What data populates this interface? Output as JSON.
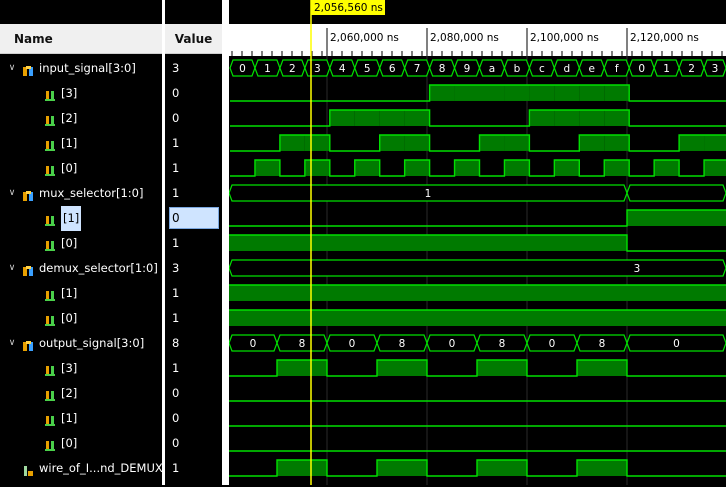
{
  "header": {
    "name_label": "Name",
    "value_label": "Value"
  },
  "cursor": {
    "label": "2,056,560 ns",
    "time_ns": 2056560
  },
  "timeline": {
    "ticks": [
      "2,060,000 ns",
      "2,080,000 ns",
      "2,100,000 ns",
      "2,120,000 ns"
    ]
  },
  "signals": [
    {
      "name": "input_signal[3:0]",
      "value": "3",
      "kind": "bus",
      "expanded": true,
      "indent": 0
    },
    {
      "name": "[3]",
      "value": "0",
      "kind": "bit",
      "indent": 1
    },
    {
      "name": "[2]",
      "value": "0",
      "kind": "bit",
      "indent": 1
    },
    {
      "name": "[1]",
      "value": "1",
      "kind": "bit",
      "indent": 1
    },
    {
      "name": "[0]",
      "value": "1",
      "kind": "bit",
      "indent": 1
    },
    {
      "name": "mux_selector[1:0]",
      "value": "1",
      "kind": "bus",
      "expanded": true,
      "indent": 0
    },
    {
      "name": "[1]",
      "value": "0",
      "kind": "bit",
      "indent": 1,
      "selected": true
    },
    {
      "name": "[0]",
      "value": "1",
      "kind": "bit",
      "indent": 1
    },
    {
      "name": "demux_selector[1:0]",
      "value": "3",
      "kind": "bus",
      "expanded": true,
      "indent": 0
    },
    {
      "name": "[1]",
      "value": "1",
      "kind": "bit",
      "indent": 1
    },
    {
      "name": "[0]",
      "value": "1",
      "kind": "bit",
      "indent": 1
    },
    {
      "name": "output_signal[3:0]",
      "value": "8",
      "kind": "bus",
      "expanded": true,
      "indent": 0
    },
    {
      "name": "[3]",
      "value": "1",
      "kind": "bit",
      "indent": 1
    },
    {
      "name": "[2]",
      "value": "0",
      "kind": "bit",
      "indent": 1
    },
    {
      "name": "[1]",
      "value": "0",
      "kind": "bit",
      "indent": 1
    },
    {
      "name": "[0]",
      "value": "0",
      "kind": "bit",
      "indent": 1
    },
    {
      "name": "wire_of_I...nd_DEMUX",
      "value": "1",
      "kind": "wire",
      "indent": 0
    }
  ],
  "bus_labels": {
    "input": [
      "0",
      "1",
      "2",
      "3",
      "4",
      "5",
      "6",
      "7",
      "8",
      "9",
      "a",
      "b",
      "c",
      "d",
      "e",
      "f",
      "0",
      "1",
      "2",
      "3"
    ],
    "mux": [
      "1"
    ],
    "demux": [
      "3"
    ],
    "output": [
      "0",
      "8",
      "0",
      "8",
      "0",
      "8",
      "0",
      "8",
      "0"
    ]
  },
  "colors": {
    "wave": "#00e000",
    "high_fill": "#007a00",
    "cursor": "#ffff00",
    "bus_text": "#ffffff"
  }
}
